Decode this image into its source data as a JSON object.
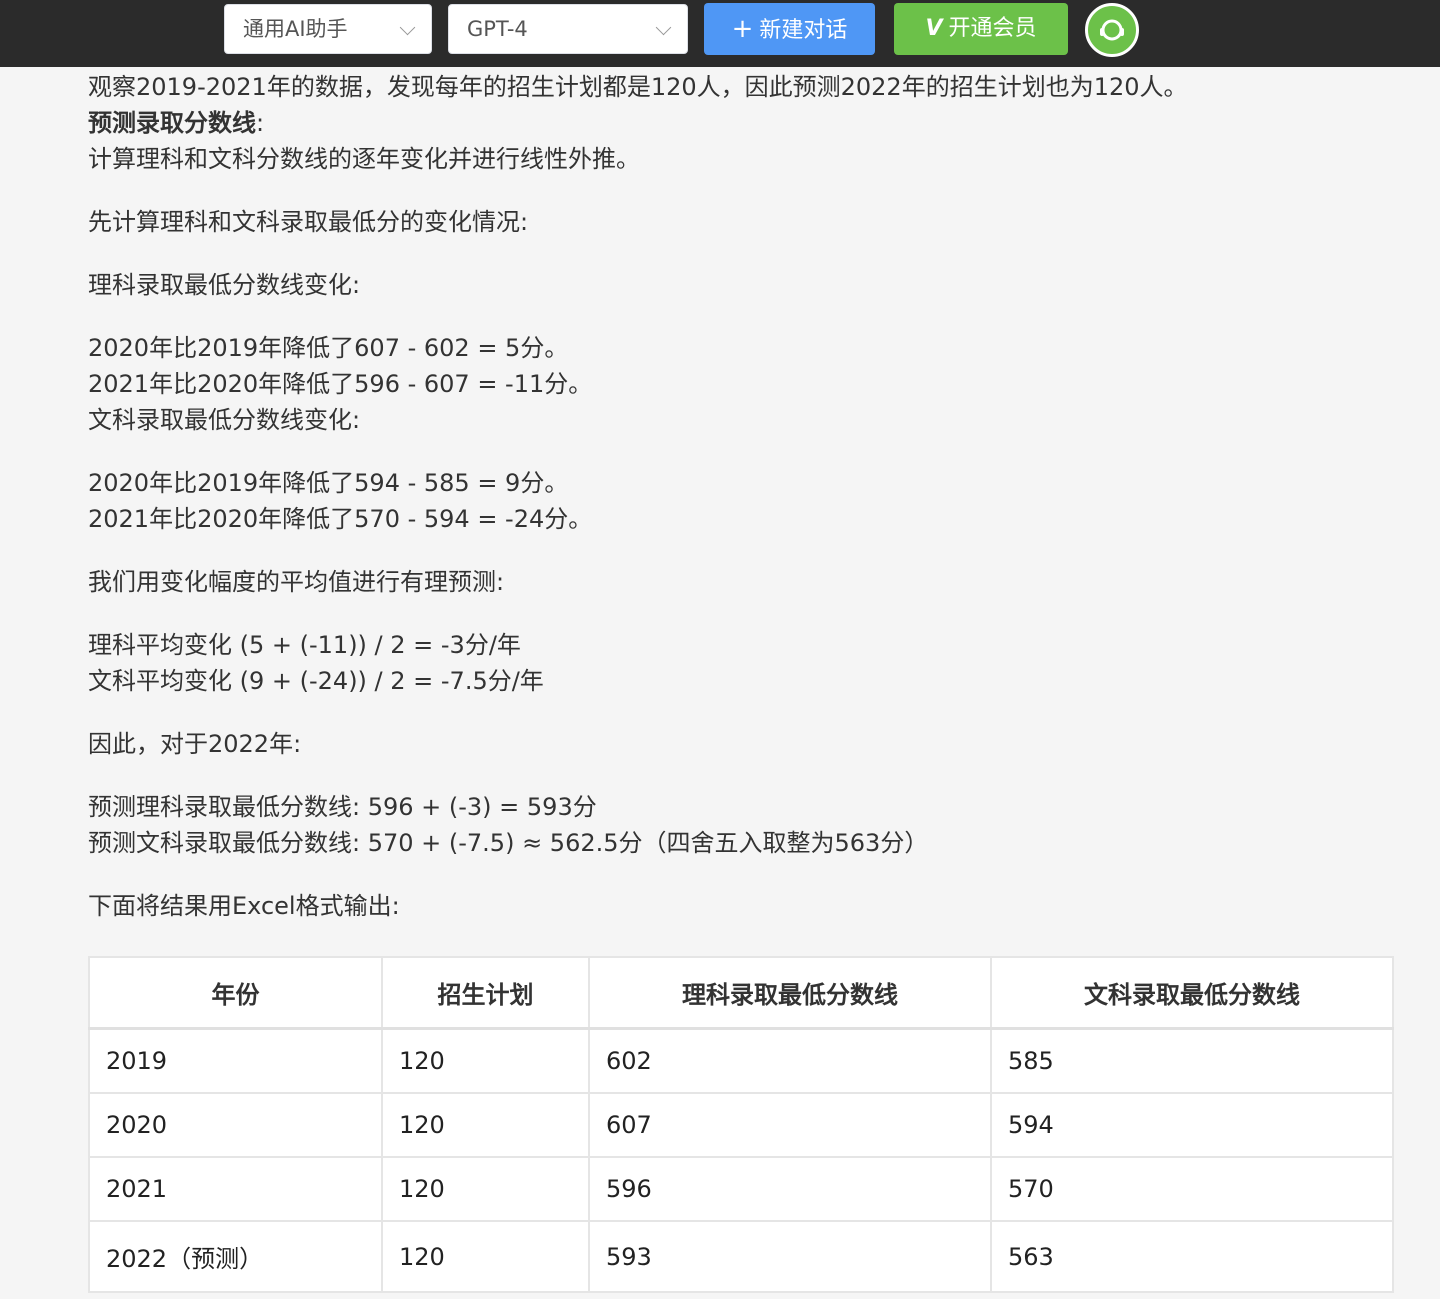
{
  "topbar": {
    "assistant_select": "通用AI助手",
    "model_select": "GPT-4",
    "new_chat_label": "新建对话",
    "vip_mark": "V",
    "vip_label": "开通会员"
  },
  "content": {
    "line1": "观察2019-2021年的数据，发现每年的招生计划都是120人，因此预测2022年的招生计划也为120人。",
    "heading_predict": "预测录取分数线",
    "heading_colon": ":",
    "line3": "计算理科和文科分数线的逐年变化并进行线性外推。",
    "line4": "先计算理科和文科录取最低分的变化情况:",
    "line5": "理科录取最低分数线变化:",
    "line6": "2020年比2019年降低了607 - 602 = 5分。",
    "line7": "2021年比2020年降低了596 - 607 = -11分。",
    "line8": "文科录取最低分数线变化:",
    "line9": "2020年比2019年降低了594 - 585 = 9分。",
    "line10": "2021年比2020年降低了570 - 594 = -24分。",
    "line11": "我们用变化幅度的平均值进行有理预测:",
    "line12": "理科平均变化 (5 + (-11)) / 2 = -3分/年",
    "line13": "文科平均变化 (9 + (-24)) / 2 = -7.5分/年",
    "line14": "因此，对于2022年:",
    "line15": "预测理科录取最低分数线: 596 + (-3) = 593分",
    "line16": "预测文科录取最低分数线: 570 + (-7.5) ≈ 562.5分（四舍五入取整为563分）",
    "line17": "下面将结果用Excel格式输出:"
  },
  "table": {
    "headers": [
      "年份",
      "招生计划",
      "理科录取最低分数线",
      "文科录取最低分数线"
    ],
    "rows": [
      [
        "2019",
        "120",
        "602",
        "585"
      ],
      [
        "2020",
        "120",
        "607",
        "594"
      ],
      [
        "2021",
        "120",
        "596",
        "570"
      ],
      [
        "2022（预测）",
        "120",
        "593",
        "563"
      ]
    ]
  }
}
